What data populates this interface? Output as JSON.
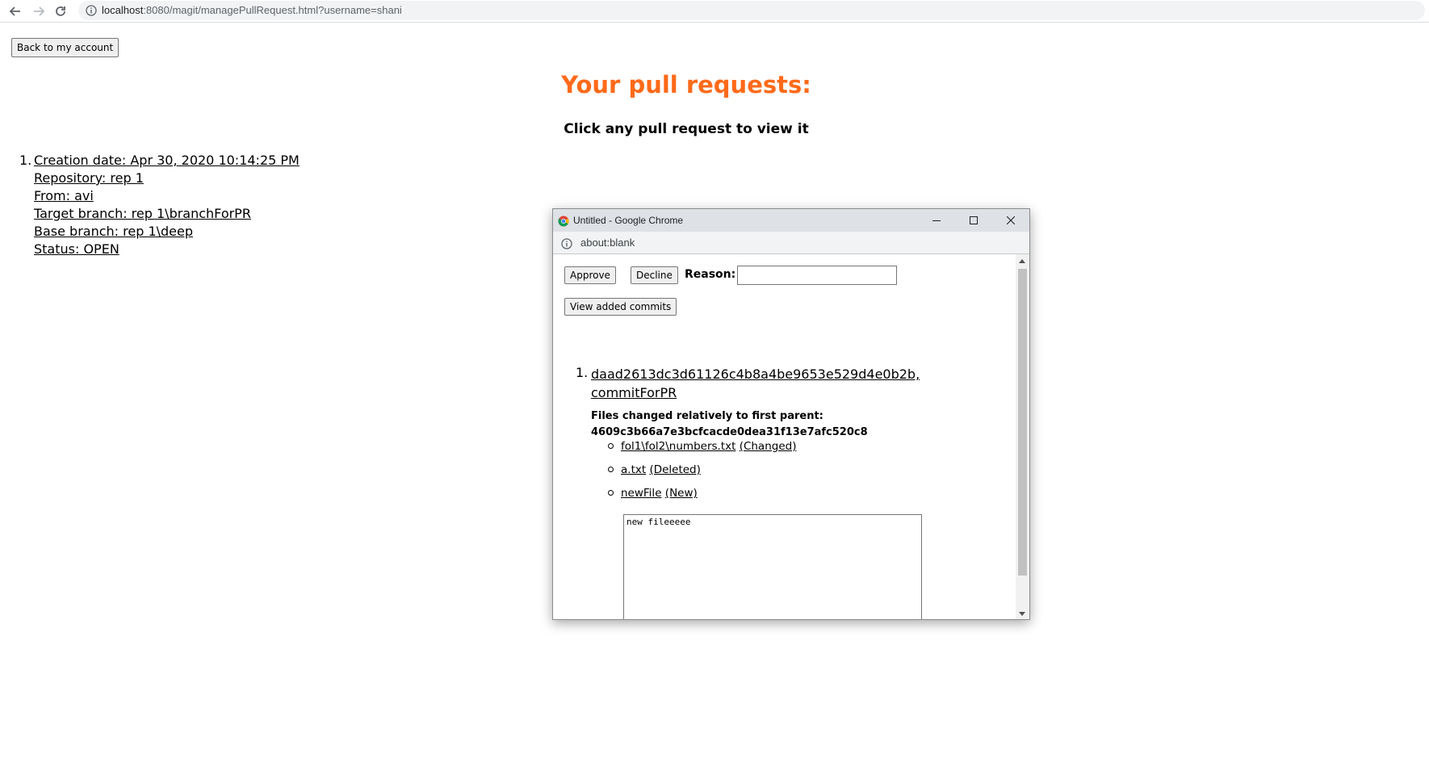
{
  "browser": {
    "url_host": "localhost",
    "url_rest": ":8080/magit/managePullRequest.html?username=shani"
  },
  "page": {
    "back_button": "Back to my account",
    "title": "Your pull requests:",
    "subtitle": "Click any pull request to view it",
    "pull_requests": [
      {
        "number": "1.",
        "lines": [
          "Creation date: Apr 30, 2020 10:14:25 PM",
          "Repository: rep 1",
          "From: avi",
          "Target branch: rep 1\\branchForPR",
          "Base branch: rep 1\\deep",
          "Status: OPEN"
        ]
      }
    ]
  },
  "popup": {
    "window_title": "Untitled - Google Chrome",
    "address": "about:blank",
    "approve_label": "Approve",
    "decline_label": "Decline",
    "reason_label": "Reason:",
    "reason_value": "",
    "view_commits_label": "View added commits",
    "commit": {
      "number": "1.",
      "sha_line": "daad2613dc3d61126c4b8a4be9653e529d4e0b2b,",
      "message": "commitForPR",
      "files_header": "Files changed relatively to first parent:",
      "parent_sha": "4609c3b66a7e3bcfcacde0dea31f13e7afc520c8",
      "files": [
        {
          "name": "fol1\\fol2\\numbers.txt",
          "status": "(Changed)"
        },
        {
          "name": "a.txt",
          "status": "(Deleted)"
        },
        {
          "name": "newFile",
          "status": "(New)"
        }
      ],
      "file_content": "new fileeeee"
    }
  },
  "icons": {
    "back": "arrow-left-icon",
    "forward": "arrow-right-icon",
    "reload": "reload-icon",
    "info": "info-icon",
    "chrome": "chrome-logo-icon",
    "minimize": "minimize-icon",
    "maximize": "maximize-icon",
    "close": "close-icon"
  },
  "colors": {
    "title": "#ff6a1a",
    "chrome_titlebar": "#dee1e6"
  }
}
